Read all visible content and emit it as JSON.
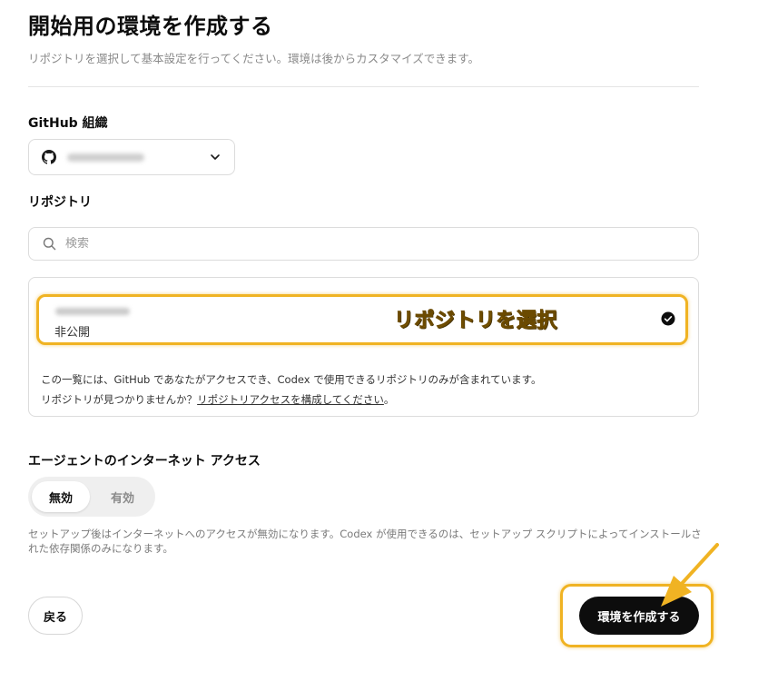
{
  "page": {
    "title": "開始用の環境を作成する",
    "subtitle": "リポジトリを選択して基本設定を行ってください。環境は後からカスタマイズできます。"
  },
  "org": {
    "label": "GitHub 組織",
    "selected": "",
    "icon": "github-icon"
  },
  "repo": {
    "label": "リポジトリ",
    "search_placeholder": "検索",
    "items": [
      {
        "name": "",
        "visibility": "非公開",
        "selected": true
      }
    ],
    "callout": "リポジトリを選択",
    "note_line1": "この一覧には、GitHub であなたがアクセスでき、Codex で使用できるリポジトリのみが含まれています。",
    "note_line2_prefix": "リポジトリが見つかりませんか？",
    "note_link": "リポジトリアクセスを構成してください",
    "note_line2_suffix": "。"
  },
  "internet": {
    "label": "エージェントのインターネット アクセス",
    "options": [
      "無効",
      "有効"
    ],
    "selected": "無効",
    "help": "セットアップ後はインターネットへのアクセスが無効になります。Codex が使用できるのは、セットアップ スクリプトによってインストールされた依存関係のみになります。"
  },
  "actions": {
    "back": "戻る",
    "create": "環境を作成する"
  },
  "colors": {
    "highlight": "#f0b323",
    "primary_button": "#0d0d0d",
    "callout_text": "#fbc22a"
  }
}
